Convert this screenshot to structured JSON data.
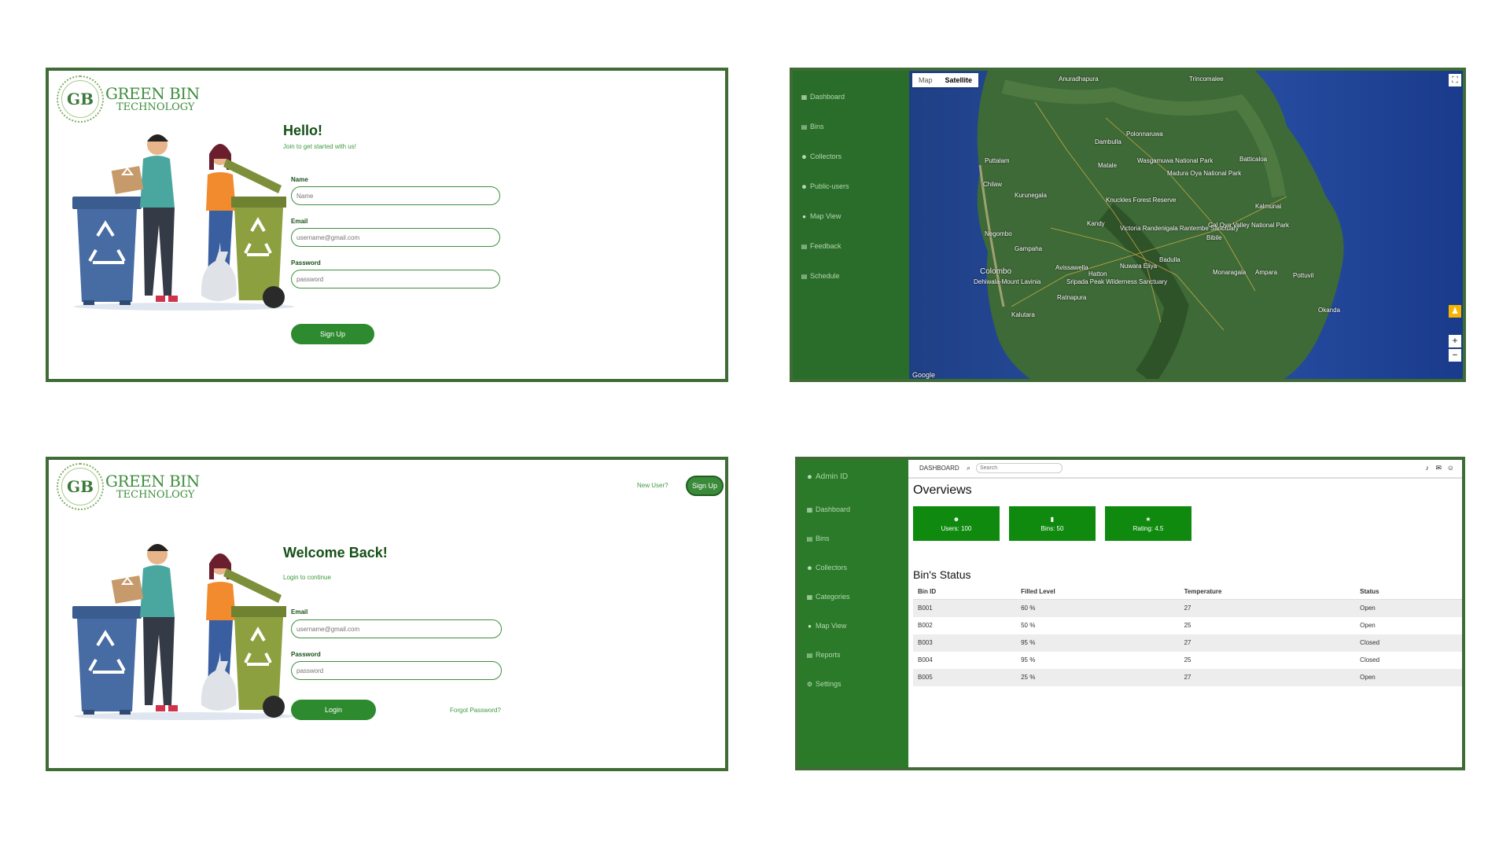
{
  "brand": {
    "line1": "GREEN BIN",
    "line2": "TECHNOLOGY",
    "badge": "GB"
  },
  "signup": {
    "title": "Hello!",
    "subtitle": "Join to get started with us!",
    "name_label": "Name",
    "name_placeholder": "Name",
    "email_label": "Email",
    "email_placeholder": "username@gmail.com",
    "password_label": "Password",
    "password_placeholder": "password",
    "button": "Sign Up"
  },
  "login": {
    "title": "Welcome Back!",
    "subtitle": "Login to continue",
    "email_label": "Email",
    "email_placeholder": "username@gmail.com",
    "password_label": "Password",
    "password_placeholder": "password",
    "button": "Login",
    "forgot": "Forgot Password?",
    "new_user": "New User?",
    "signup_button": "Sign Up"
  },
  "map_view": {
    "sidebar": [
      {
        "label": "Dashboard",
        "icon": "dashboard-icon"
      },
      {
        "label": "Bins",
        "icon": "bin-icon"
      },
      {
        "label": "Collectors",
        "icon": "users-icon"
      },
      {
        "label": "Public-users",
        "icon": "users-icon"
      },
      {
        "label": "Map View",
        "icon": "map-pin-icon"
      },
      {
        "label": "Feedback",
        "icon": "feedback-icon"
      },
      {
        "label": "Schedule",
        "icon": "calendar-icon"
      }
    ],
    "tabs": [
      "Map",
      "Satellite"
    ],
    "active_tab": "Satellite",
    "attribution": "Google",
    "places": [
      "Colombo",
      "Dehiwala-Mount Lavinia",
      "Negombo",
      "Kandy",
      "Knuckles Forest Reserve",
      "Anuradhapura",
      "Polonnaruwa",
      "Victoria Randenigala Rantembe Sanctuary",
      "Madura Oya National Park",
      "Wasgamuwa National Park",
      "Gal Oya Valley National Park",
      "Ampara",
      "Batticaloa",
      "Kalmunai",
      "Trincomalee",
      "Kurunegala",
      "Puttalam",
      "Chilaw",
      "Gampaha",
      "Avissawella",
      "Hatton",
      "Nuwara Eliya",
      "Badulla",
      "Sripada Peak Wilderness Sanctuary",
      "Ratnapura",
      "Bibile",
      "Monaragala",
      "Pottuvil",
      "Okanda",
      "Dambulla",
      "Matale",
      "Kalutara"
    ]
  },
  "admin": {
    "admin_id": "Admin ID",
    "sidebar": [
      {
        "label": "Dashboard",
        "icon": "dashboard-icon"
      },
      {
        "label": "Bins",
        "icon": "bin-icon"
      },
      {
        "label": "Collectors",
        "icon": "users-icon"
      },
      {
        "label": "Categories",
        "icon": "grid-icon"
      },
      {
        "label": "Map View",
        "icon": "map-pin-icon"
      },
      {
        "label": "Reports",
        "icon": "report-icon"
      },
      {
        "label": "Settings",
        "icon": "gear-icon"
      }
    ],
    "topbar_title": "DASHBOARD",
    "search_placeholder": "Search",
    "overview_title": "Overviews",
    "stats": [
      {
        "label": "Users: 100",
        "icon": "users-icon"
      },
      {
        "label": "Bins: 50",
        "icon": "bin-icon"
      },
      {
        "label": "Rating: 4.5",
        "icon": "star-icon"
      }
    ],
    "status_title": "Bin's Status",
    "columns": [
      "Bin ID",
      "Filled Level",
      "Temperature",
      "Status"
    ],
    "rows": [
      [
        "B001",
        "60 %",
        "27",
        "Open"
      ],
      [
        "B002",
        "50 %",
        "25",
        "Open"
      ],
      [
        "B003",
        "95 %",
        "27",
        "Closed"
      ],
      [
        "B004",
        "95 %",
        "25",
        "Closed"
      ],
      [
        "B005",
        "25 %",
        "27",
        "Open"
      ]
    ]
  },
  "colors": {
    "brand_green": "#2e8a2e",
    "sidebar_green": "#2a6d2a",
    "frame_green": "#3f6b35",
    "card_green": "#0f8a0f"
  }
}
